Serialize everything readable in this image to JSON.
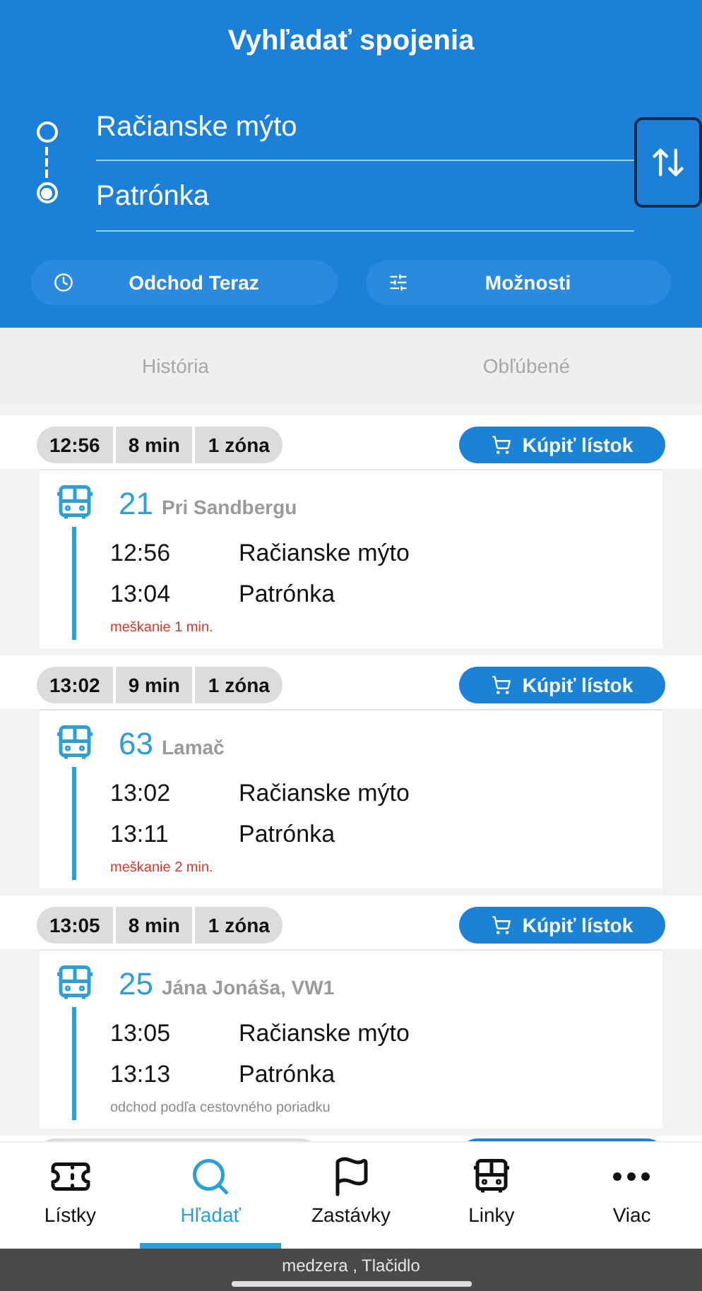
{
  "header": {
    "title": "Vyhľadať spojenia",
    "from": "Račianske mýto",
    "to": "Patrónka",
    "departure_button": "Odchod Teraz",
    "options_button": "Možnosti"
  },
  "tabs": [
    {
      "label": "História",
      "selected": false
    },
    {
      "label": "Obľúbené",
      "selected": false
    }
  ],
  "trips": [
    {
      "time": "12:56",
      "duration": "8 min",
      "zones": "1 zóna",
      "buy": "Kúpiť lístok",
      "line": "21",
      "direction": "Pri Sandbergu",
      "stops": [
        {
          "time": "12:56",
          "name": "Račianske mýto"
        },
        {
          "time": "13:04",
          "name": "Patrónka"
        }
      ],
      "note": {
        "kind": "delay",
        "text": "meškanie 1 min."
      }
    },
    {
      "time": "13:02",
      "duration": "9 min",
      "zones": "1 zóna",
      "buy": "Kúpiť lístok",
      "line": "63",
      "direction": "Lamač",
      "stops": [
        {
          "time": "13:02",
          "name": "Račianske mýto"
        },
        {
          "time": "13:11",
          "name": "Patrónka"
        }
      ],
      "note": {
        "kind": "delay",
        "text": "meškanie 2 min."
      }
    },
    {
      "time": "13:05",
      "duration": "8 min",
      "zones": "1 zóna",
      "buy": "Kúpiť lístok",
      "line": "25",
      "direction": "Jána Jonáša, VW1",
      "stops": [
        {
          "time": "13:05",
          "name": "Račianske mýto"
        },
        {
          "time": "13:13",
          "name": "Patrónka"
        }
      ],
      "note": {
        "kind": "schedule",
        "text": "odchod podľa cestovného poriadku"
      }
    }
  ],
  "bottom_nav": [
    {
      "label": "Lístky",
      "kind": "tickets",
      "selected": false
    },
    {
      "label": "Hľadať",
      "kind": "search",
      "selected": true
    },
    {
      "label": "Zastávky",
      "kind": "stops",
      "selected": false
    },
    {
      "label": "Linky",
      "kind": "lines",
      "selected": false
    },
    {
      "label": "Viac",
      "kind": "more",
      "selected": false
    }
  ],
  "status_bar": "medzera , Tlačidlo"
}
